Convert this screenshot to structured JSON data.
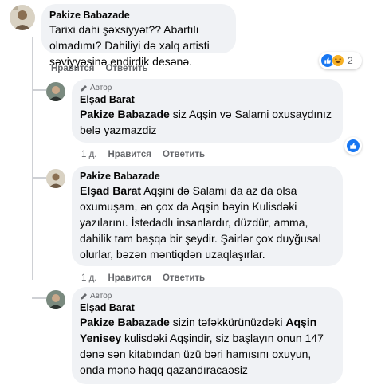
{
  "comments": [
    {
      "author": "Pakize Babazade",
      "text": "Tarixi dahi şəxsiyyət?? Abartılı olmadımı? Dahiliyi də xalq artisti səviyyəsinə endirdik desənə.",
      "actions": {
        "like": "Нравится",
        "reply": "Ответить"
      },
      "reactions_count": "2"
    },
    {
      "badge": "Автор",
      "author": "Elşad Barat",
      "mention": "Pakize Babazade",
      "text": " siz Aqşin və Salami oxusaydınız belə yazmazdiz",
      "actions": {
        "time": "1 д.",
        "like": "Нравится",
        "reply": "Ответить"
      }
    },
    {
      "author": "Pakize Babazade",
      "mention": "Elşad Barat",
      "text": " Aqşini də Salamı da az da olsa oxumuşam, ən çox da Aqşin bəyin Kulisdəki yazılarını. İstedadlı insanlardır, düzdür, amma, dahilik tam başqa bir şeydir. Şairlər çox duyğusal olurlar, bəzən məntiqdən uzaqlaşırlar.",
      "actions": {
        "time": "1 д.",
        "like": "Нравится",
        "reply": "Ответить"
      }
    },
    {
      "badge": "Автор",
      "author": "Elşad Barat",
      "mention": "Pakize Babazade",
      "text_a": " sizin təfəkkürünüzdəki ",
      "mention2": "Aqşin Yenisey",
      "text_b": " kulisdəki Aqşindir, siz başlayın onun 147 dənə sən kitabından üzü bəri hamısını oxuyun, onda mənə haqq qazandıracaəsiz"
    }
  ],
  "colors": {
    "like_blue": "#1877f2",
    "haha_yellow": "#f7b125",
    "link_gray": "#65676b"
  }
}
